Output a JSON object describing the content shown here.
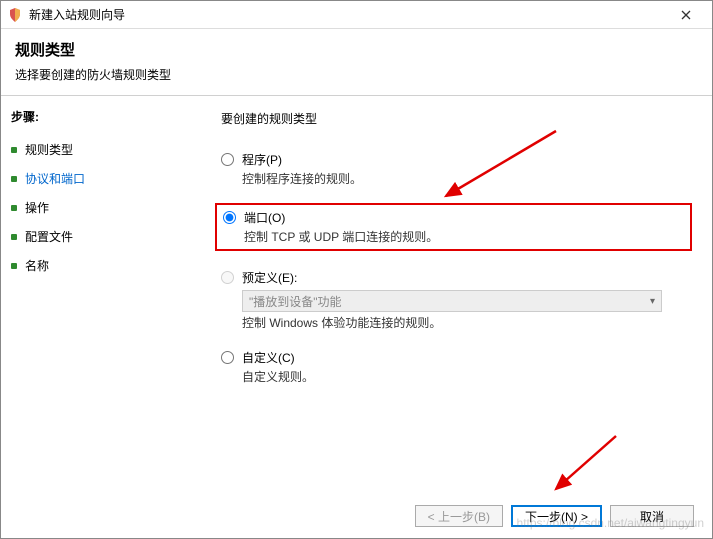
{
  "window": {
    "title": "新建入站规则向导"
  },
  "header": {
    "title": "规则类型",
    "subtitle": "选择要创建的防火墙规则类型"
  },
  "sidebar": {
    "heading": "步骤:",
    "items": [
      {
        "label": "规则类型"
      },
      {
        "label": "协议和端口"
      },
      {
        "label": "操作"
      },
      {
        "label": "配置文件"
      },
      {
        "label": "名称"
      }
    ]
  },
  "content": {
    "prompt": "要创建的规则类型",
    "options": {
      "program": {
        "label": "程序(P)",
        "desc": "控制程序连接的规则。"
      },
      "port": {
        "label": "端口(O)",
        "desc": "控制 TCP 或 UDP 端口连接的规则。"
      },
      "predefined": {
        "label": "预定义(E):",
        "desc": "控制 Windows 体验功能连接的规则。",
        "selected": "\"播放到设备\"功能"
      },
      "custom": {
        "label": "自定义(C)",
        "desc": "自定义规则。"
      }
    }
  },
  "buttons": {
    "back": "< 上一步(B)",
    "next": "下一步(N) >",
    "cancel": "取消"
  },
  "watermark": "https://blog.csdn.net/aiwangtingyun"
}
